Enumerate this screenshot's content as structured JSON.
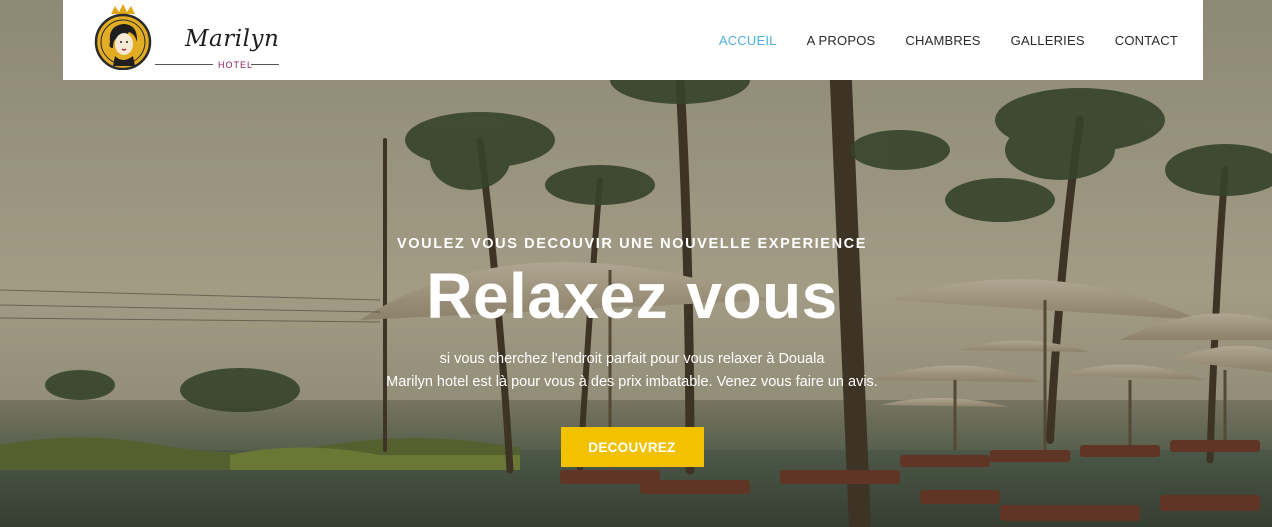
{
  "brand": {
    "name": "Marilyn",
    "subtitle": "HOTEL",
    "colors": {
      "accent_nav": "#4fb0e0",
      "cta": "#f2c200",
      "brand_sub": "#8b1f5a"
    }
  },
  "nav": {
    "items": [
      {
        "label": "ACCUEIL",
        "active": true
      },
      {
        "label": "A PROPOS",
        "active": false
      },
      {
        "label": "CHAMBRES",
        "active": false
      },
      {
        "label": "GALLERIES",
        "active": false
      },
      {
        "label": "CONTACT",
        "active": false
      }
    ]
  },
  "hero": {
    "kicker": "VOULEZ VOUS DECOUVIR UNE NOUVELLE EXPERIENCE",
    "headline": "Relaxez vous",
    "desc_line1": "si vous cherchez l'endroit parfait pour vous relaxer à Douala",
    "desc_line2": "Marilyn hotel est là pour vous à des prix imbatable. Venez vous faire un avis.",
    "cta_label": "DECOUVREZ",
    "background": "resort-pool-palm-trees-image"
  }
}
